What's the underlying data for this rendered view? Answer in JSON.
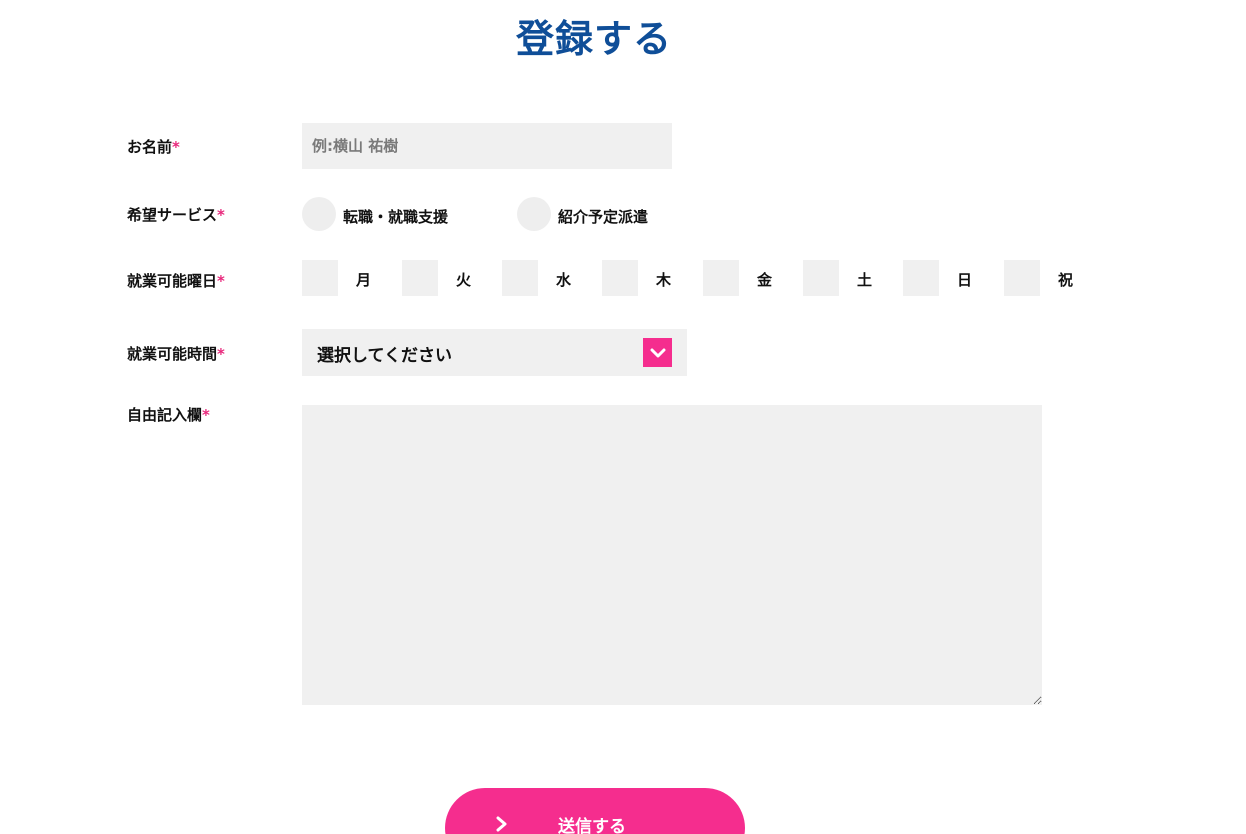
{
  "title": "登録する",
  "required_mark": "*",
  "colors": {
    "title": "#0f4e98",
    "accent": "#f52d8e",
    "required": "#e8287c",
    "field_bg": "#f0f0f0"
  },
  "fields": {
    "name": {
      "label": "お名前",
      "placeholder": "例:横山 祐樹"
    },
    "service": {
      "label": "希望サービス",
      "options": [
        "転職・就職支援",
        "紹介予定派遣"
      ]
    },
    "days": {
      "label": "就業可能曜日",
      "options": [
        "月",
        "火",
        "水",
        "木",
        "金",
        "土",
        "日",
        "祝"
      ]
    },
    "time": {
      "label": "就業可能時間",
      "selected": "選択してください",
      "arrow_icon": "chevron-down-icon"
    },
    "free_text": {
      "label": "自由記入欄",
      "value": ""
    }
  },
  "submit": {
    "label": "送信する",
    "icon": "chevron-right-icon"
  }
}
